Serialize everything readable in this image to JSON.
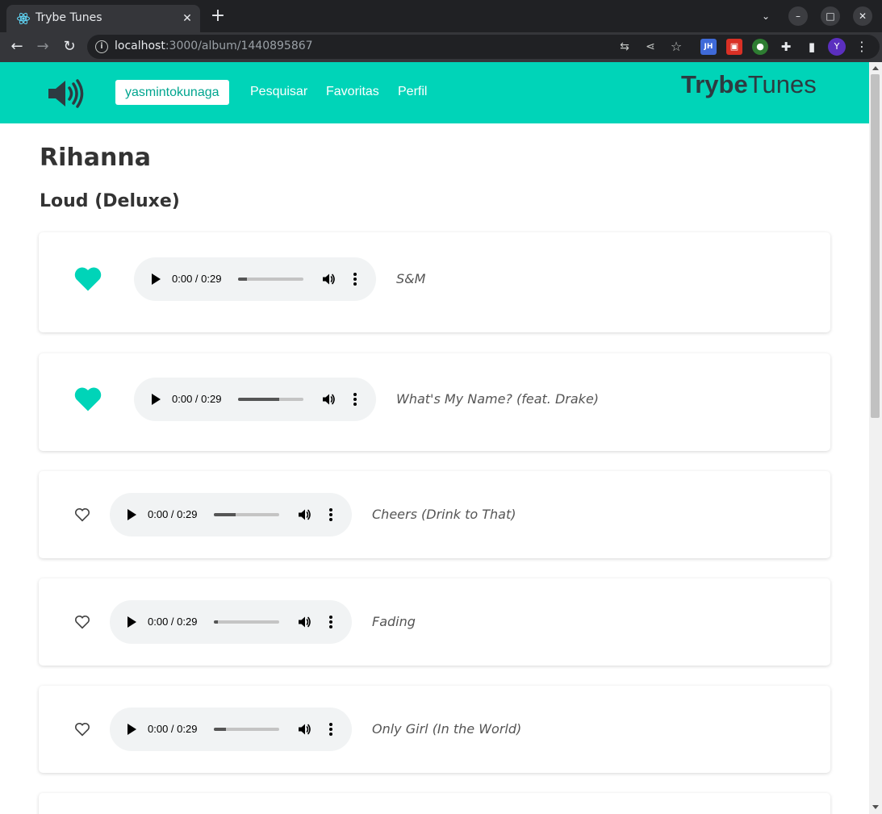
{
  "browser": {
    "tab_title": "Trybe Tunes",
    "tab_close": "✕",
    "new_tab": "+",
    "url_host": "localhost",
    "url_rest": ":3000/album/1440895867",
    "avatar_letter": "Y",
    "ext_jh": "JH"
  },
  "header": {
    "user": "yasmintokunaga",
    "nav": [
      "Pesquisar",
      "Favoritas",
      "Perfil"
    ],
    "logo_bold": "Trybe",
    "logo_light": "Tunes"
  },
  "artist": "Rihanna",
  "album": "Loud (Deluxe)",
  "tracks": [
    {
      "name": "S&M",
      "favorite": true,
      "time": "0:00 / 0:29",
      "progress": 0.13
    },
    {
      "name": "What's My Name? (feat. Drake)",
      "favorite": true,
      "time": "0:00 / 0:29",
      "progress": 0.63
    },
    {
      "name": "Cheers (Drink to That)",
      "favorite": false,
      "time": "0:00 / 0:29",
      "progress": 0.33
    },
    {
      "name": "Fading",
      "favorite": false,
      "time": "0:00 / 0:29",
      "progress": 0.06
    },
    {
      "name": "Only Girl (In the World)",
      "favorite": false,
      "time": "0:00 / 0:29",
      "progress": 0.18
    }
  ],
  "colors": {
    "accent": "#00d4b8",
    "favorite": "#00d4b8"
  }
}
